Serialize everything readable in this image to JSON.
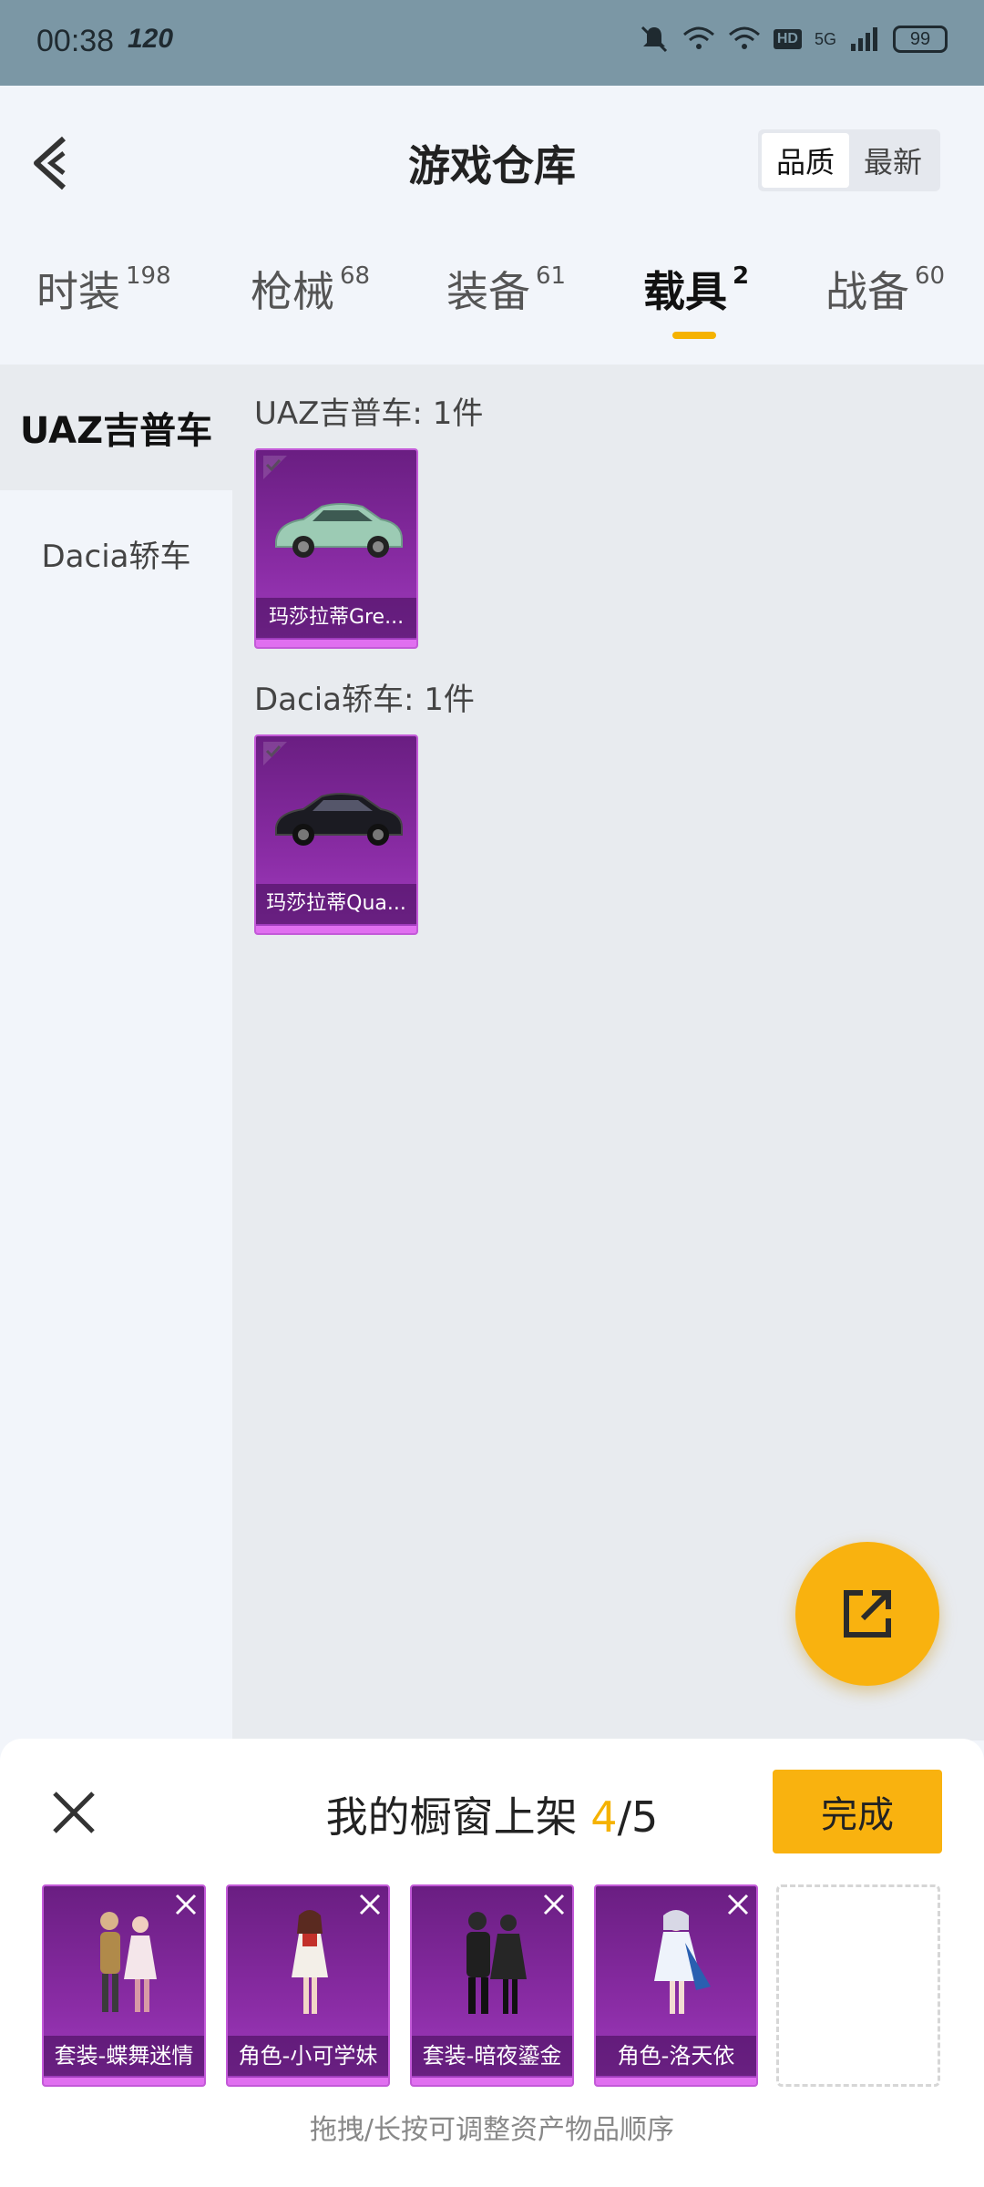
{
  "status_bar": {
    "time": "00:38",
    "refresh": "120",
    "network": "5G",
    "hd": "HD",
    "battery": "99"
  },
  "header": {
    "title": "游戏仓库",
    "sort": {
      "quality": "品质",
      "newest": "最新"
    }
  },
  "tabs": [
    {
      "label": "时装",
      "count": "198"
    },
    {
      "label": "枪械",
      "count": "68"
    },
    {
      "label": "装备",
      "count": "61"
    },
    {
      "label": "载具",
      "count": "2"
    },
    {
      "label": "战备",
      "count": "60"
    }
  ],
  "left_nav": [
    {
      "label": "UAZ吉普车"
    },
    {
      "label": "Dacia轿车"
    }
  ],
  "sections": [
    {
      "title": "UAZ吉普车: 1件",
      "items": [
        {
          "name": "玛莎拉蒂Gre...",
          "color": "#9ccbb4"
        }
      ]
    },
    {
      "title": "Dacia轿车: 1件",
      "items": [
        {
          "name": "玛莎拉蒂Qua...",
          "color": "#1b1b22"
        }
      ]
    }
  ],
  "panel": {
    "title_prefix": "我的橱窗上架 ",
    "count": "4",
    "total": "/5",
    "done": "完成",
    "items": [
      {
        "name": "套装-蝶舞迷情"
      },
      {
        "name": "角色-小可学妹"
      },
      {
        "name": "套装-暗夜鎏金"
      },
      {
        "name": "角色-洛天依"
      }
    ],
    "hint": "拖拽/长按可调整资产物品顺序"
  },
  "colors": {
    "accent": "#f9b20f",
    "card_purple": "#8a2ca5"
  }
}
